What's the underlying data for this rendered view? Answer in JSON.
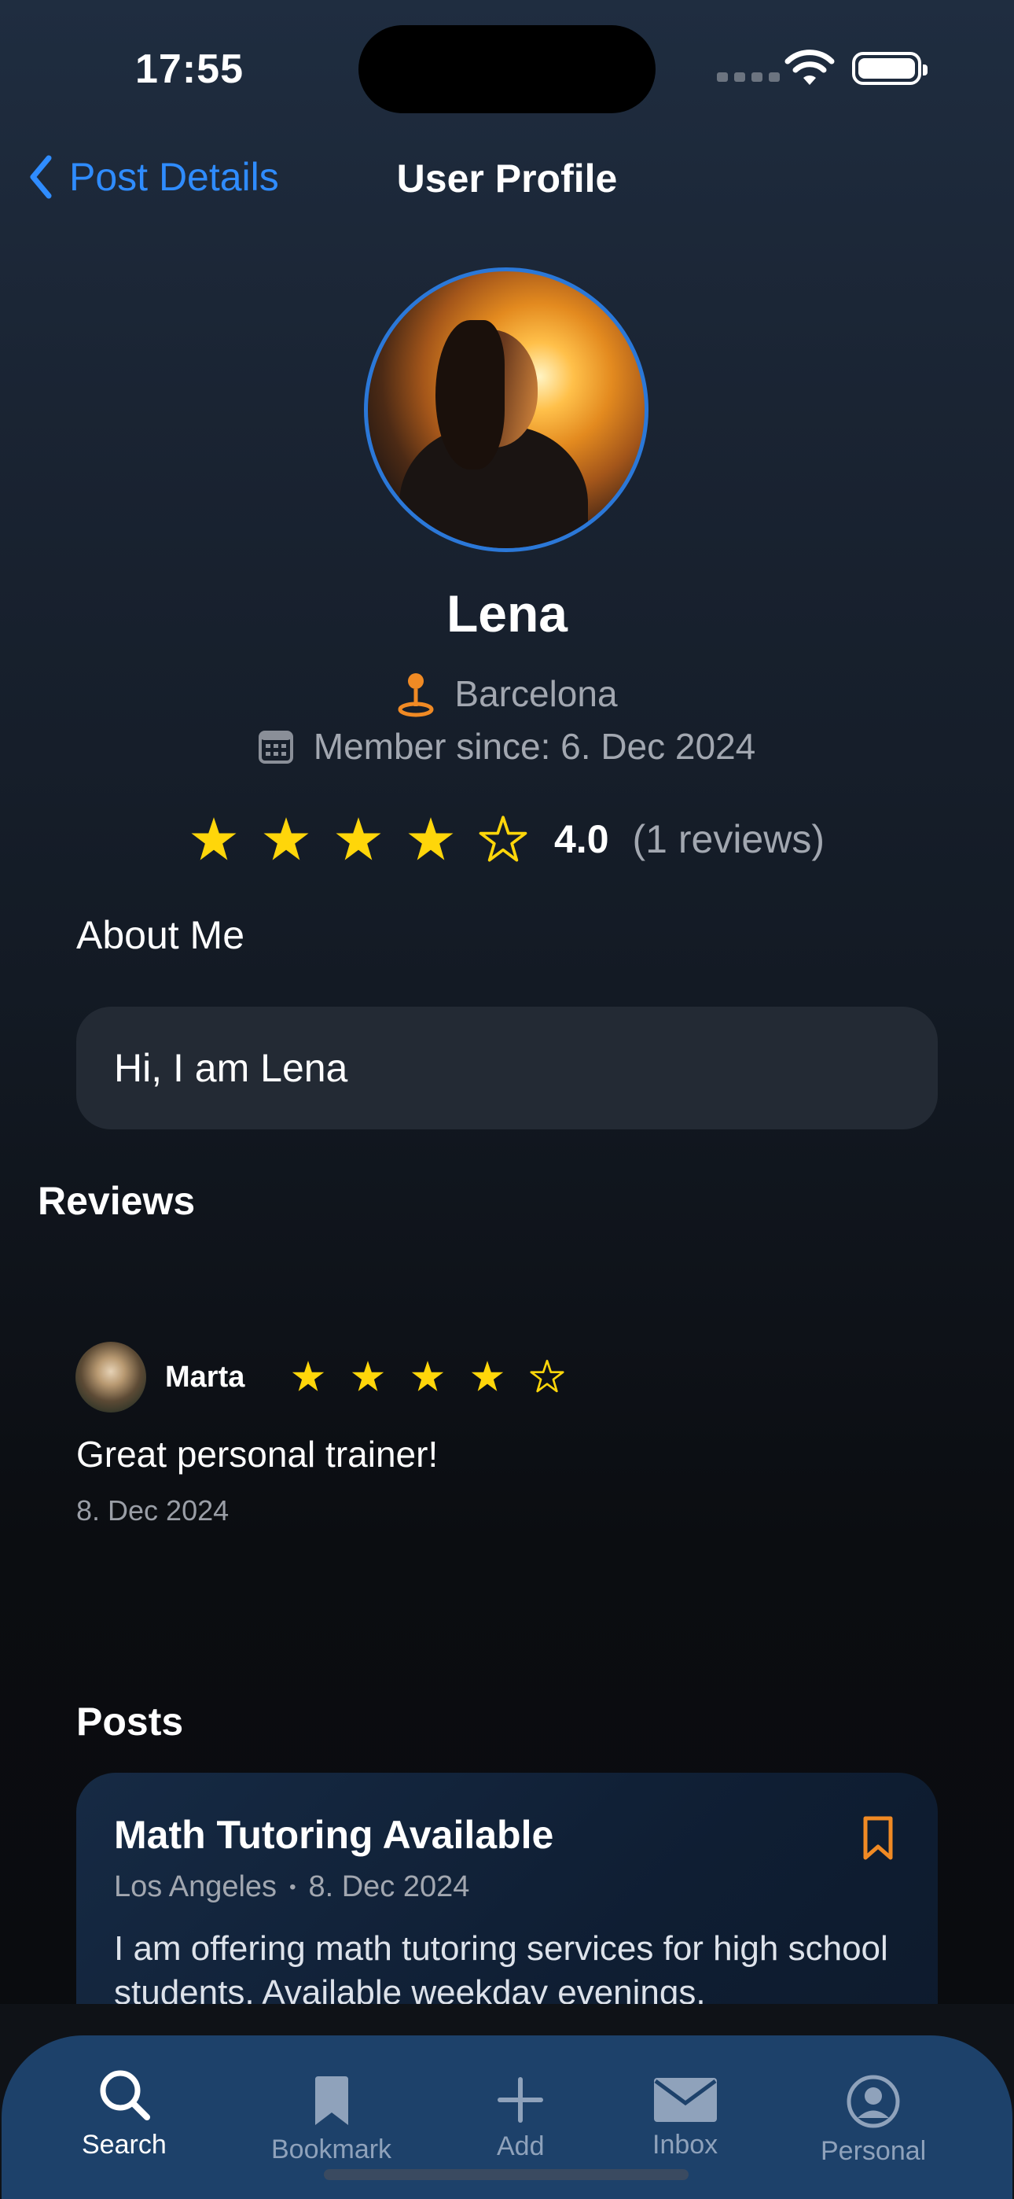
{
  "status_bar": {
    "time": "17:55"
  },
  "nav": {
    "back_label": "Post Details",
    "title": "User Profile"
  },
  "profile": {
    "name": "Lena",
    "location": "Barcelona",
    "member_since": "Member since: 6. Dec 2024",
    "rating_value": "4.0",
    "rating_count": "(1 reviews)",
    "stars_filled": 4,
    "stars_total": 5
  },
  "about": {
    "heading": "About Me",
    "text": "Hi, I am Lena"
  },
  "reviews": {
    "heading": "Reviews",
    "items": [
      {
        "author": "Marta",
        "stars_filled": 4,
        "text": "Great personal trainer!",
        "date": "8. Dec 2024"
      }
    ]
  },
  "posts": {
    "heading": "Posts",
    "items": [
      {
        "title": "Math Tutoring Available",
        "location": "Los Angeles",
        "separator": "•",
        "date": "8. Dec 2024",
        "body": " I am offering math tutoring services for high school students. Available weekday evenings."
      }
    ]
  },
  "tabbar": {
    "items": [
      {
        "label": "Search",
        "icon": "search-icon",
        "active": true
      },
      {
        "label": "Bookmark",
        "icon": "bookmark-icon",
        "active": false
      },
      {
        "label": "Add",
        "icon": "plus-icon",
        "active": false
      },
      {
        "label": "Inbox",
        "icon": "envelope-icon",
        "active": false
      },
      {
        "label": "Personal",
        "icon": "person-circle-icon",
        "active": false
      }
    ]
  },
  "colors": {
    "accent": "#2f8cff",
    "star": "#ffd60a",
    "location_pin": "#f08a24",
    "bookmark": "#f08a24",
    "tabbar": "#1d416a"
  }
}
